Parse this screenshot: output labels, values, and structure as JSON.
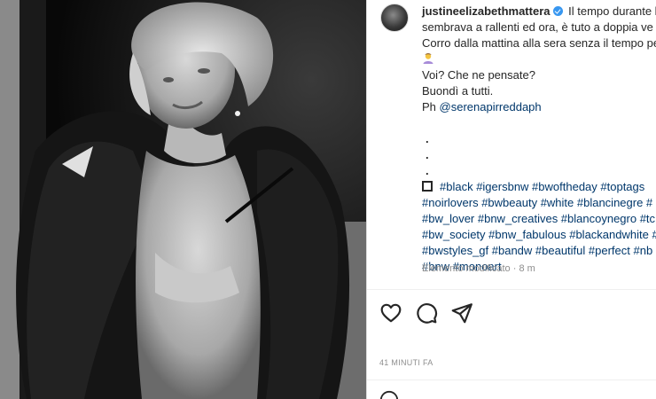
{
  "post": {
    "username": "justineelizabethmattera",
    "caption_lines": [
      "Il tempo durante l",
      "sembrava a rallenti ed ora, è tuto a doppia ve",
      "Corro dalla mattina alla sera senza il tempo pe"
    ],
    "question": "Voi? Che ne pensate?",
    "greeting": "Buondì a tutti.",
    "photo_prefix": "Ph",
    "photographer": "@serenapirreddaph",
    "dots": [
      ".",
      ".",
      "."
    ],
    "hashtag_lines": [
      "#black #igersbnw #bwoftheday #toptags",
      "#noirlovers #bwbeauty #white #blancinegre #",
      "#bw_lover #bnw_creatives #blancoynegro #tc",
      "#bw_society #bnw_fabulous #blackandwhite #",
      "#bwstyles_gf #bandw #beautiful #perfect #nb",
      "#bnw #monoart"
    ],
    "edited_label": "Elemento modificato",
    "edited_separator": "·",
    "edited_age": "8 m",
    "time_ago": "41 MINUTI FA"
  },
  "icons": {
    "verified": "verified-badge-icon",
    "like": "heart-icon",
    "comment": "comment-icon",
    "share": "paper-plane-icon",
    "square": "black-square-icon",
    "emoji": "person-emoji-icon",
    "emoji_button": "smiley-icon"
  },
  "colors": {
    "link": "#00376b",
    "muted": "#8e8e8e",
    "verified": "#3897f0"
  }
}
